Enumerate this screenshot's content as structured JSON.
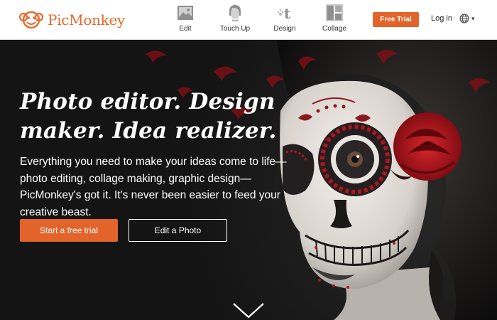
{
  "brand": {
    "name": "PicMonkey",
    "logo_icon": "monkey-face-icon",
    "color": "#e8692b"
  },
  "nav": {
    "items": [
      {
        "label": "Edit",
        "icon": "image-icon"
      },
      {
        "label": "Touch Up",
        "icon": "face-icon"
      },
      {
        "label": "Design",
        "icon": "design-text-icon"
      },
      {
        "label": "Collage",
        "icon": "collage-grid-icon"
      }
    ]
  },
  "header": {
    "free_trial_label": "Free Trial",
    "login_label": "Log in",
    "language_icon": "globe-icon"
  },
  "hero": {
    "headline": "Photo editor. Design maker. Idea realizer.",
    "subtext": "Everything you need to make your ideas come to life—photo editing, collage making, graphic design—PicMonkey's got it. It's never been easier to feed your creative beast.",
    "cta_primary": "Start a free trial",
    "cta_secondary": "Edit a Photo",
    "scroll_icon": "chevron-down-icon"
  },
  "colors": {
    "accent": "#e2642a",
    "hero_bg": "#151515",
    "rose": "#b3141c"
  }
}
